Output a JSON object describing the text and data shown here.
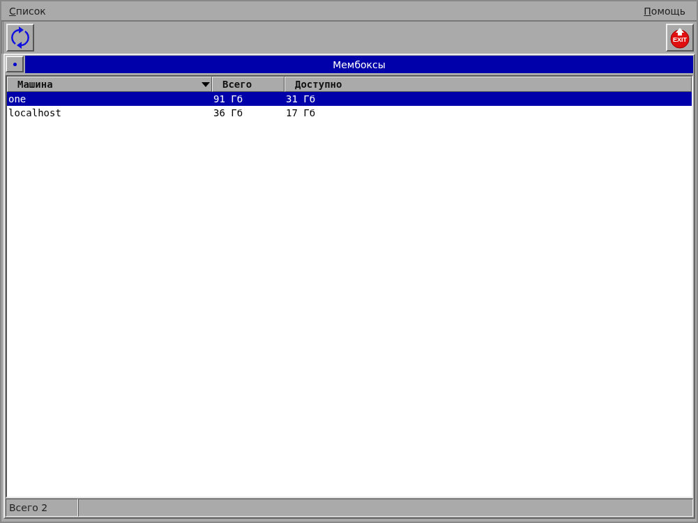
{
  "menu": [
    {
      "label": "Список"
    },
    {
      "label": "Помощь"
    }
  ],
  "toolbar": {
    "exit_label": "EXIT"
  },
  "panel": {
    "title": "Мембоксы"
  },
  "table": {
    "columns": [
      {
        "label": "Машина",
        "sorted": true
      },
      {
        "label": "Всего",
        "sorted": false
      },
      {
        "label": "Доступно",
        "sorted": false
      }
    ],
    "rows": [
      {
        "cells": [
          "one",
          "91 Гб",
          "31 Гб"
        ],
        "selected": true
      },
      {
        "cells": [
          "localhost",
          "36 Гб",
          "17 Гб"
        ],
        "selected": false
      }
    ]
  },
  "status_bar": {
    "text": "Всего 2"
  }
}
